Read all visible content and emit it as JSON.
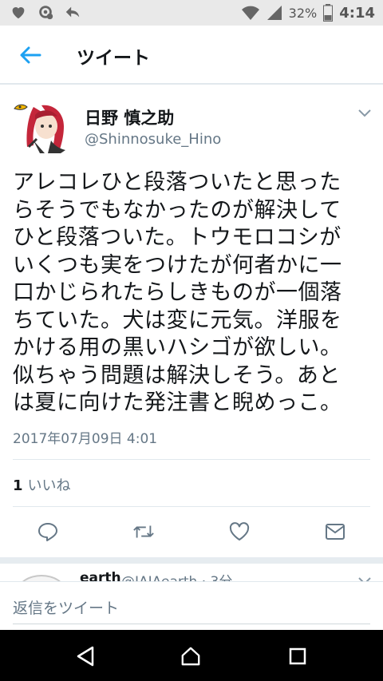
{
  "status_bar": {
    "battery_percent": "32%",
    "time": "4:14",
    "left_icons": [
      "heart-icon",
      "settings-notification-icon",
      "reply-arrow-icon"
    ],
    "right_icons": [
      "wifi-icon",
      "signal-icon",
      "battery-icon"
    ]
  },
  "app_bar": {
    "title": "ツイート",
    "back_icon": "back-arrow-icon"
  },
  "tweet": {
    "user_name": "日野 慎之助",
    "user_handle": "@Shinnosuke_Hino",
    "text_lines": [
      "アレコレひと段落ついたと思った",
      "らそうでもなかったのが解決して",
      "ひと段落ついた。トウモロコシが",
      "いくつも実をつけたが何者かに一",
      "口かじられたらしきものが一個落",
      "ちていた。犬は変に元気。洋服を",
      "かける用の黒いハシゴが欲しい。",
      "似ちゃう問題は解決しそう。あと",
      "は夏に向けた発注書と睨めっこ。"
    ],
    "timestamp": "2017年07月09日 4:01",
    "likes_count": "1",
    "likes_label": "いいね",
    "actions": [
      "reply-icon",
      "retweet-icon",
      "like-icon",
      "message-icon"
    ]
  },
  "next_tweet": {
    "name": "earth",
    "handle_partial": "@IAIAearth · 3分"
  },
  "reply": {
    "placeholder": "返信をツイート"
  },
  "colors": {
    "accent": "#1da1f2",
    "secondary_text": "#657786",
    "icon_gray": "#657786"
  }
}
